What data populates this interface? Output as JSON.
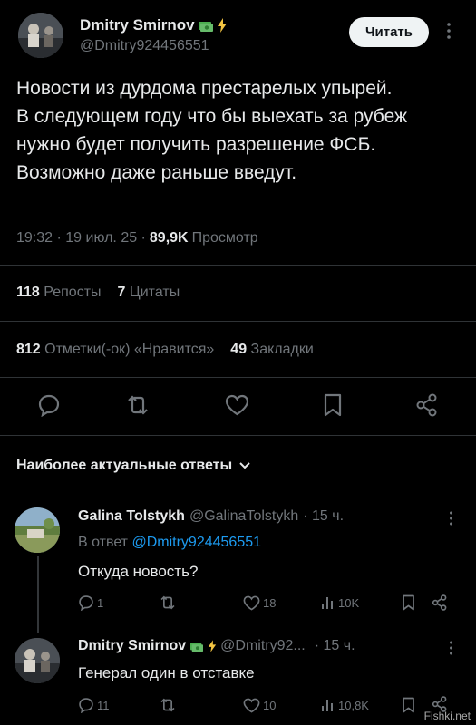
{
  "tweet": {
    "author_name": "Dmitry Smirnov",
    "author_handle": "@Dmitry924456551",
    "follow_label": "Читать",
    "text": "Новости из дурдома престарелых упырей.\nВ следующем году что бы выехать за рубеж нужно будет получить разрешение ФСБ.\nВозможно даже раньше введут.",
    "time": "19:32 · 19 июл. 25 ·",
    "views_count": "89,9K",
    "views_label": "Просмотр",
    "reposts_count": "118",
    "reposts_label": "Репосты",
    "quotes_count": "7",
    "quotes_label": "Цитаты",
    "likes_count": "812",
    "likes_label": "Отметки(-ок) «Нравится»",
    "bookmarks_count": "49",
    "bookmarks_label": "Закладки"
  },
  "replies_header": "Наиболее актуальные ответы",
  "replies": [
    {
      "author_name": "Galina Tolstykh",
      "author_handle": "@GalinaTolstykh",
      "time": "· 15 ч.",
      "reply_to_prefix": "В ответ",
      "reply_to_handle": "@Dmitry924456551",
      "text": "Откуда новость?",
      "replies_count": "1",
      "reposts_count": "",
      "likes_count": "18",
      "views_count": "10K"
    },
    {
      "author_name": "Dmitry Smirnov",
      "author_handle": "@Dmitry92...",
      "time": "· 15 ч.",
      "text": "Генерал один в отставке",
      "replies_count": "11",
      "reposts_count": "",
      "likes_count": "10",
      "views_count": "10,8K"
    }
  ],
  "watermark": "Fishki.net",
  "colors": {
    "background": "#000000",
    "text": "#e7e9ea",
    "muted": "#71767b",
    "link": "#1d9bf0",
    "divider": "#2f3336",
    "follow_button": "#eff3f4",
    "bolt": "#f4c542",
    "money": "#4caf50"
  }
}
